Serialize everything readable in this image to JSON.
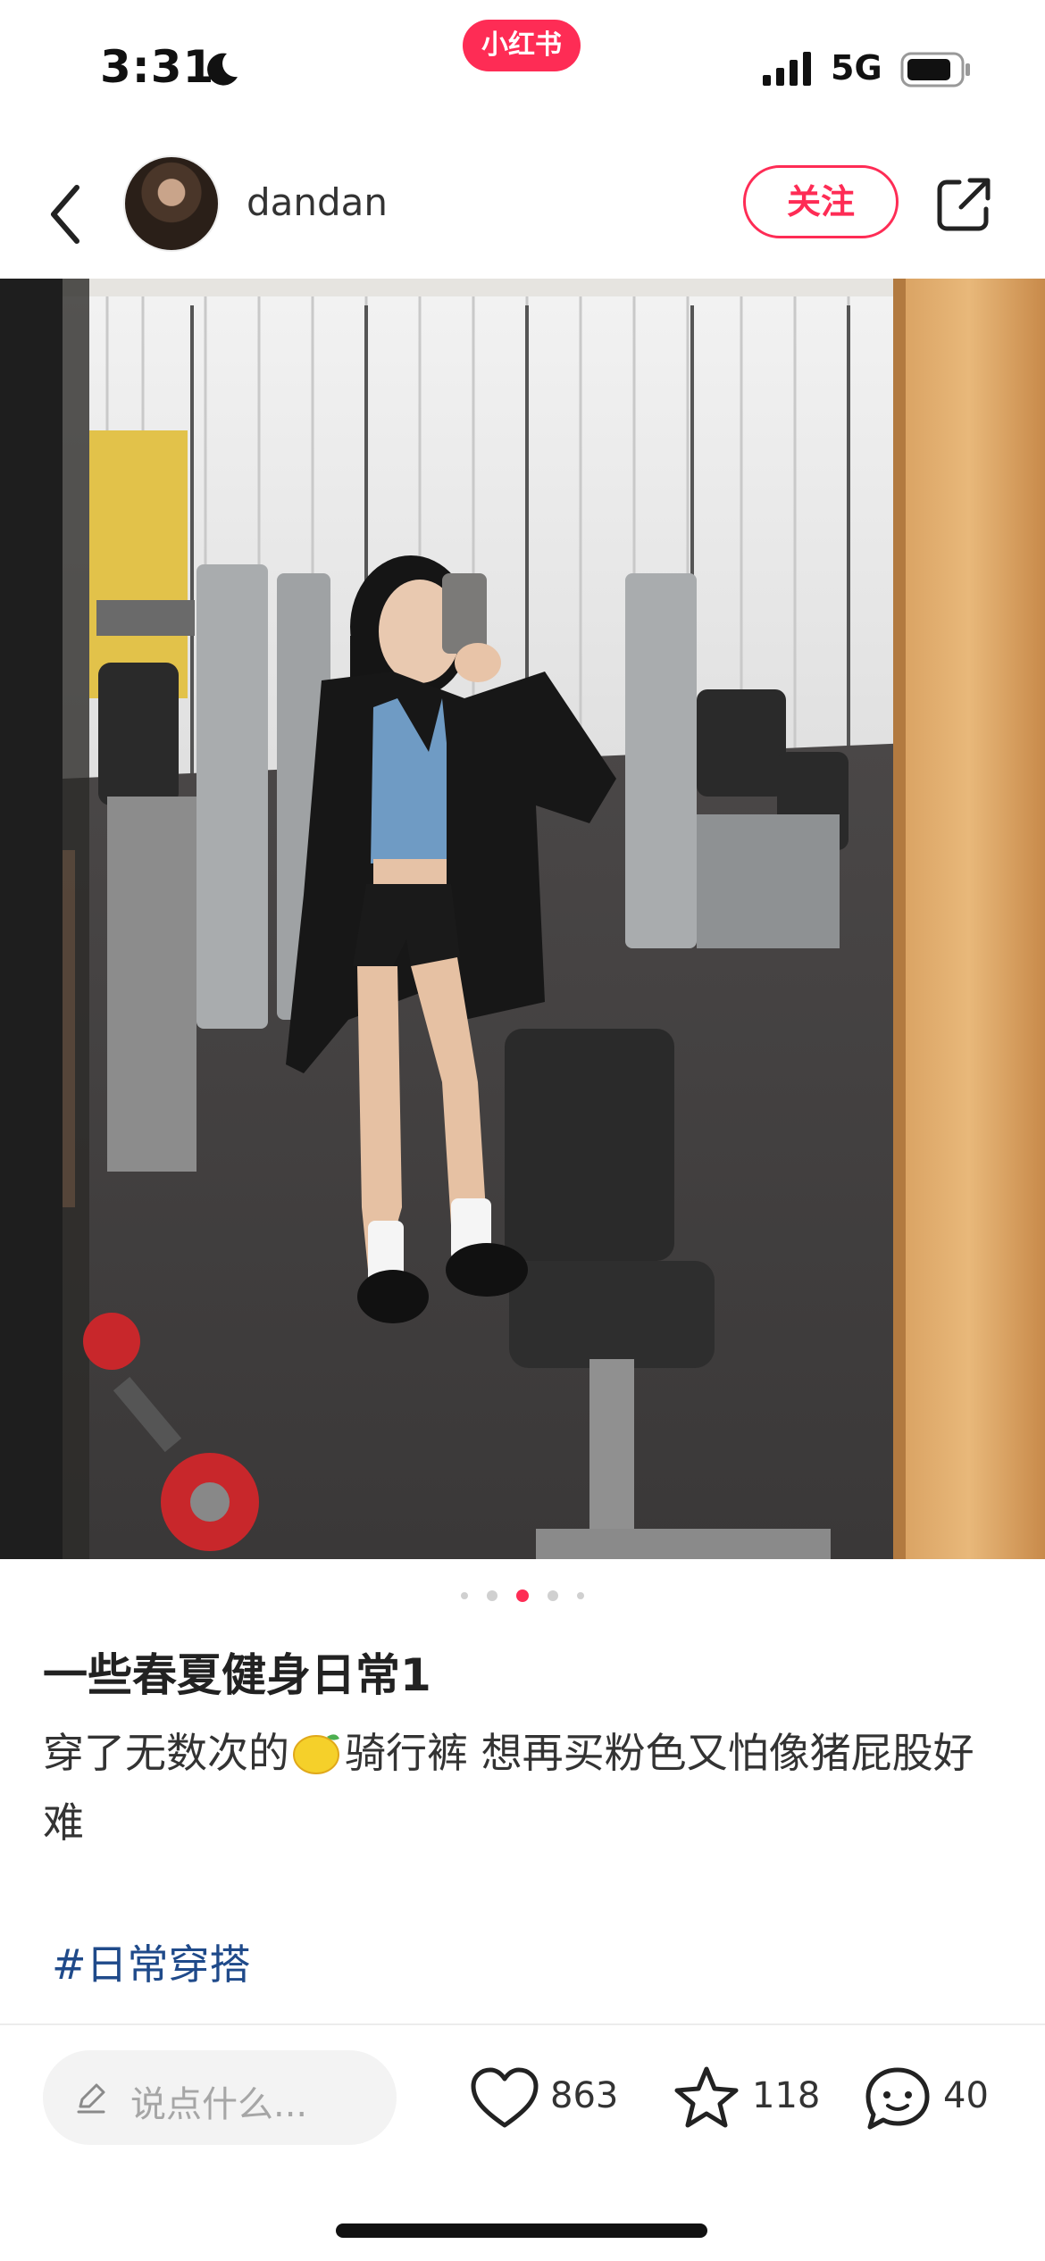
{
  "status_bar": {
    "time": "3:31",
    "app_badge": "小红书",
    "network": "5G",
    "icons": [
      "moon-icon",
      "signal-icon",
      "battery-icon"
    ]
  },
  "nav": {
    "username": "dandan",
    "follow_label": "关注",
    "icons": [
      "back-icon",
      "share-icon"
    ]
  },
  "carousel": {
    "total_pages": 5,
    "current_page": 3
  },
  "post": {
    "title": "一些春夏健身日常1",
    "body_before_emoji": "穿了无数次的",
    "emoji": "lemon-icon",
    "body_after_emoji": "骑行裤 想再买粉色又怕像猪屁股好难",
    "hashtag": "#日常穿搭"
  },
  "bottom_bar": {
    "comment_placeholder": "说点什么...",
    "likes": "863",
    "collects": "118",
    "comments": "40"
  },
  "colors": {
    "accent": "#fe2c55",
    "hashtag": "#1f4a8a",
    "text": "#222222"
  }
}
